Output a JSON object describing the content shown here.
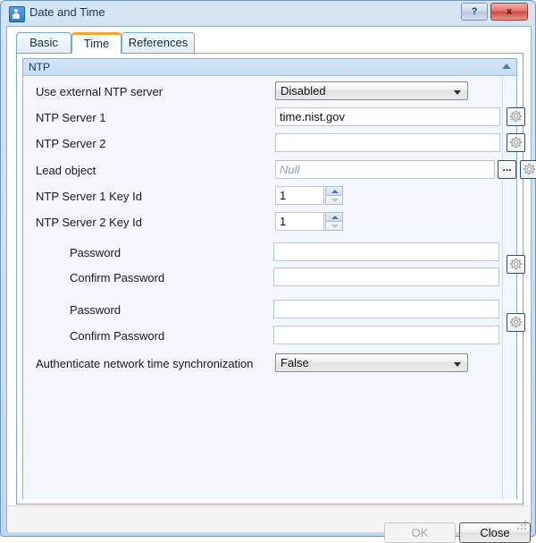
{
  "window": {
    "title": "Date and Time",
    "icon": "app-icon",
    "help_label": "?",
    "close_label": "x"
  },
  "tabs": [
    {
      "label": "Basic",
      "active": false
    },
    {
      "label": "Time",
      "active": true
    },
    {
      "label": "References",
      "active": false
    }
  ],
  "group": {
    "title": "NTP",
    "collapse_icon": "chevron-up-icon"
  },
  "rows": [
    {
      "label": "Use external NTP server",
      "type": "combo",
      "value": "Disabled"
    },
    {
      "label": "NTP Server 1",
      "type": "text",
      "value": "time.nist.gov",
      "gear": "gear-icon"
    },
    {
      "label": "NTP Server 2",
      "type": "text",
      "value": "",
      "gear": "gear-icon"
    },
    {
      "label": "Lead object",
      "type": "text",
      "value": "",
      "placeholder": "Null",
      "browse": "...",
      "gear": "gear-icon"
    },
    {
      "label": "NTP Server 1 Key Id",
      "type": "spinner",
      "value": "1"
    },
    {
      "label": "NTP Server 2 Key Id",
      "type": "spinner",
      "value": "1"
    },
    {
      "label": "Password",
      "type": "password",
      "value": "",
      "indent": true
    },
    {
      "label": "Confirm Password",
      "type": "password",
      "value": "",
      "indent": true,
      "gear": "gear-icon"
    },
    {
      "label": "Password",
      "type": "password",
      "value": "",
      "indent": true
    },
    {
      "label": "Confirm Password",
      "type": "password",
      "value": "",
      "indent": true,
      "gear": "gear-icon"
    },
    {
      "label": "Authenticate network time synchronization",
      "type": "combo",
      "value": "False"
    }
  ],
  "footer": {
    "ok_label": "OK",
    "ok_enabled": false,
    "close_label": "Close",
    "close_enabled": true,
    "grip_icon": "resize-grip-icon"
  },
  "colors": {
    "accent_tab": "#f0a830",
    "group_header": "#c5dcf3",
    "panel_bg": "#f1f7fd",
    "close_button": "#cf4a40"
  }
}
